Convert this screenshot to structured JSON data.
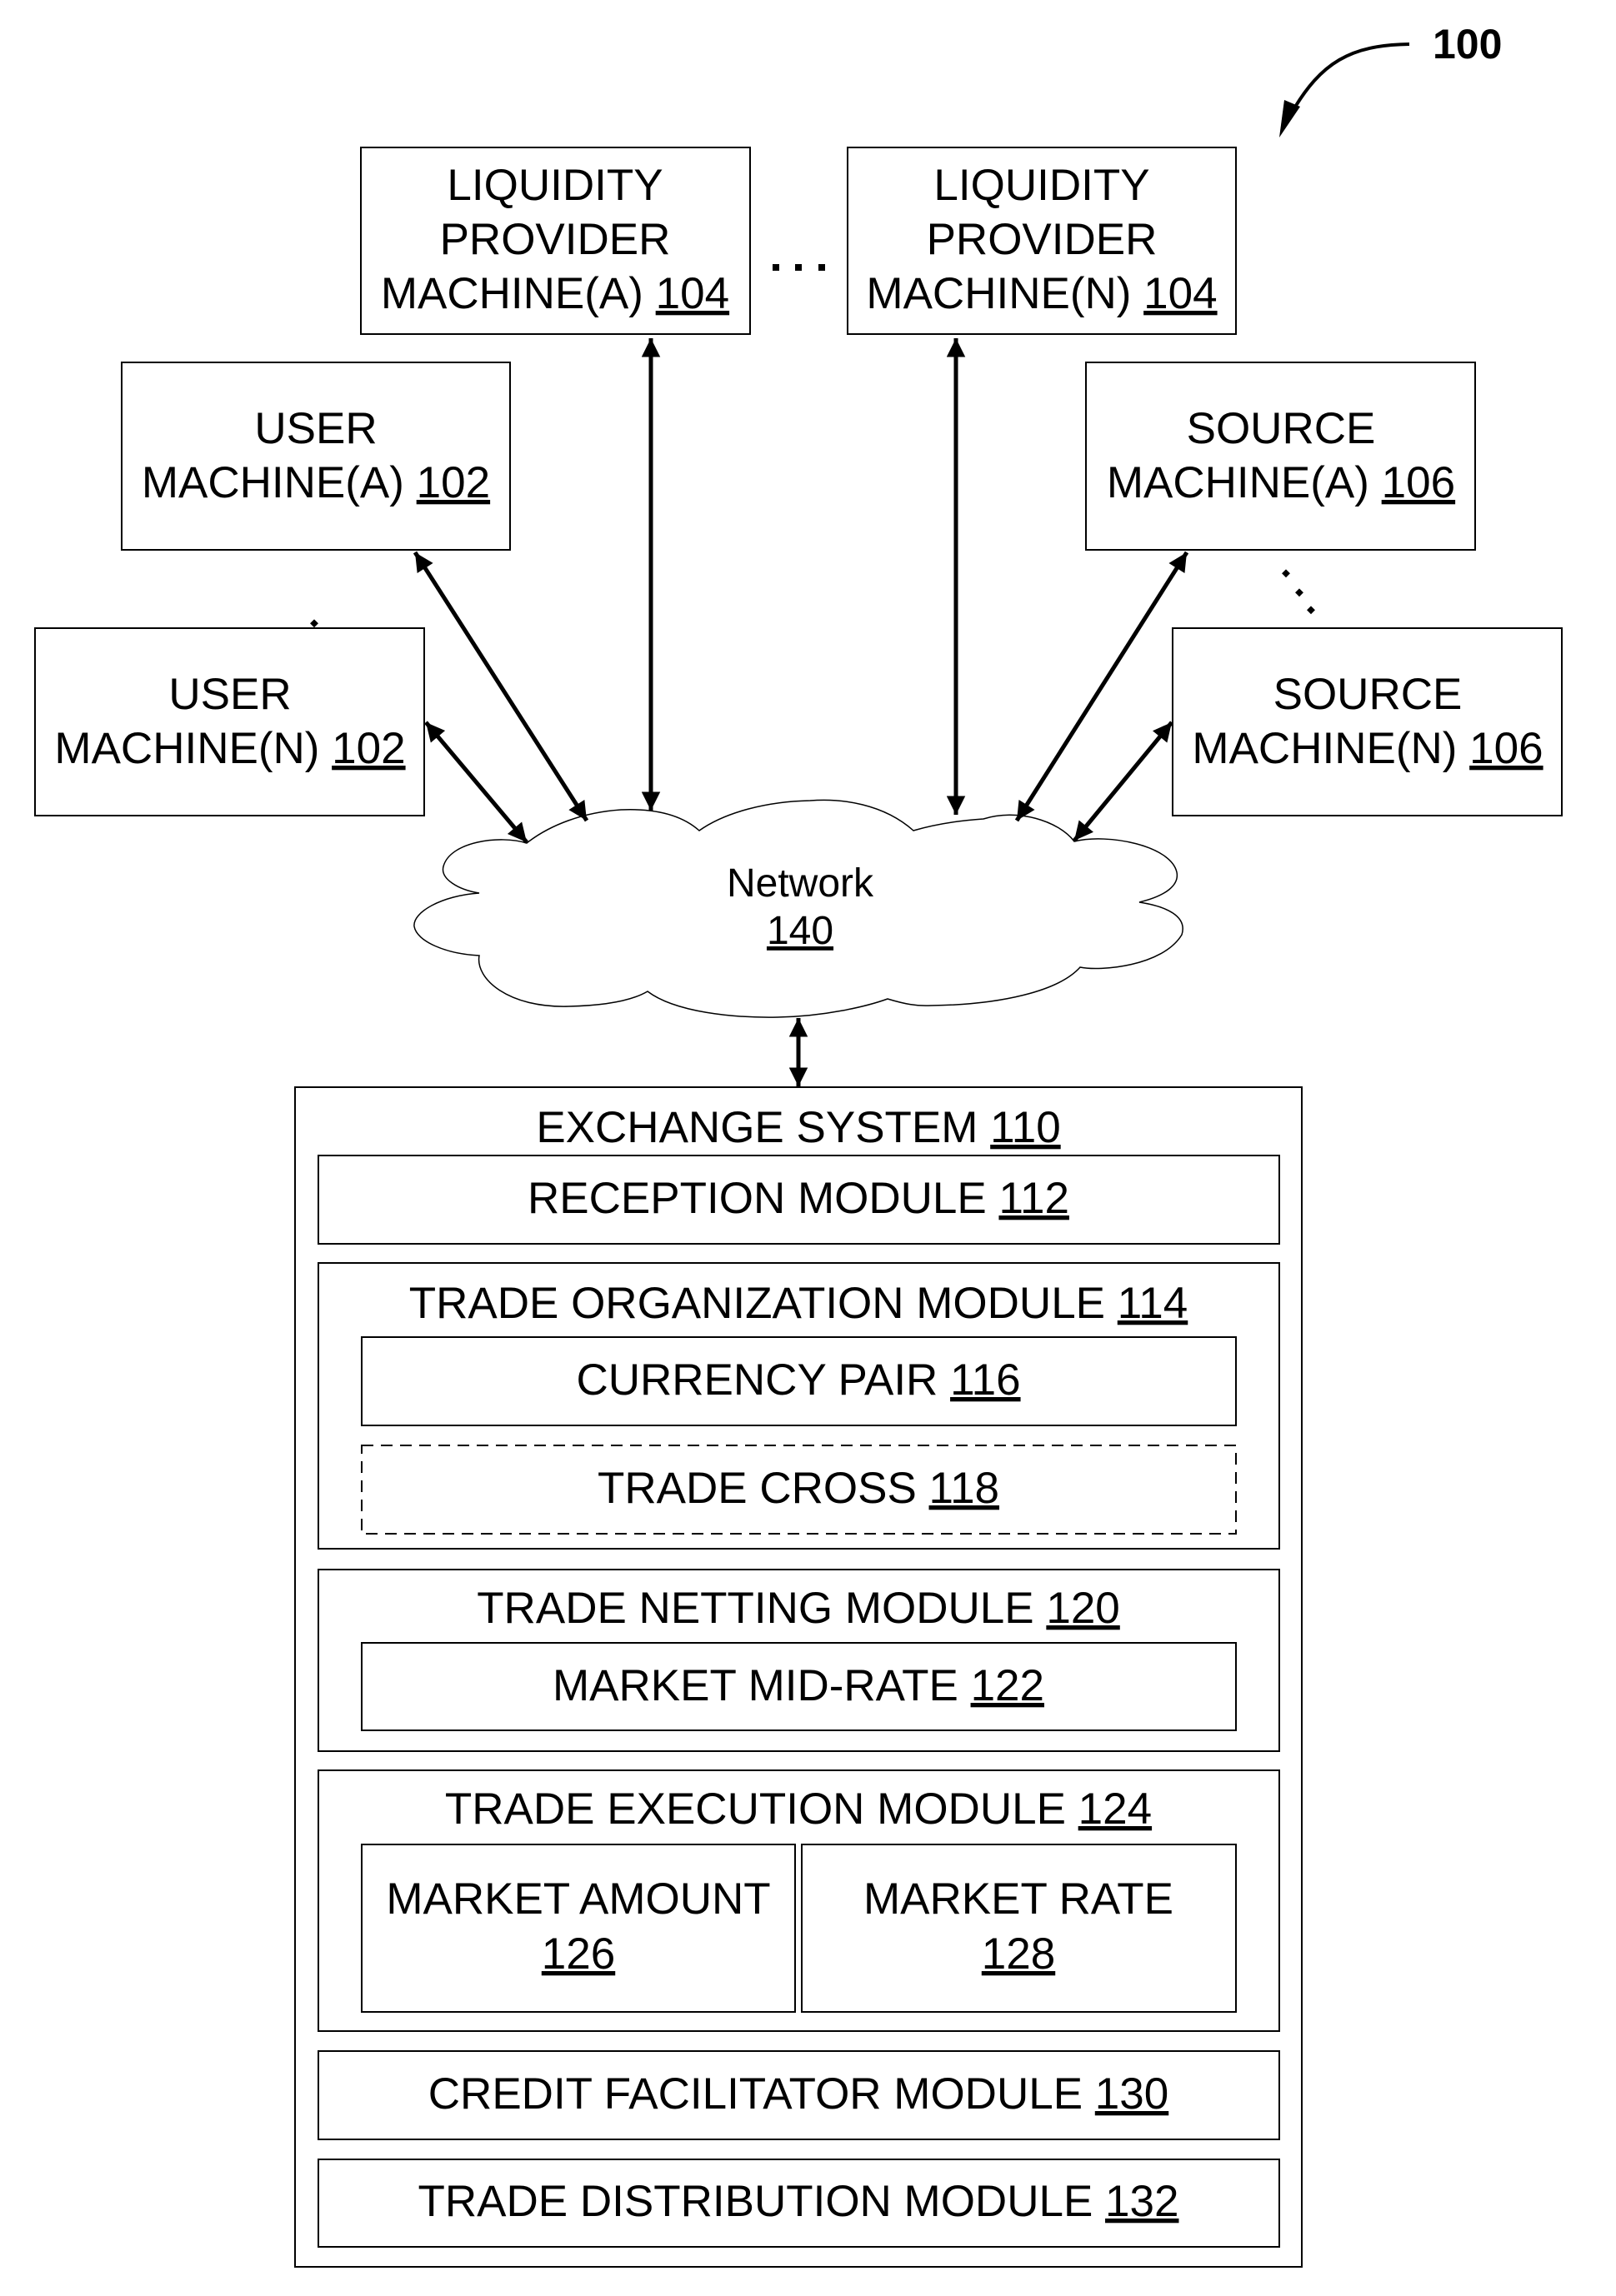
{
  "figure": {
    "reference_label": "100"
  },
  "liquidity_providers": [
    {
      "lines": [
        "LIQUIDITY",
        "PROVIDER",
        "MACHINE(A)"
      ],
      "ref": "104"
    },
    {
      "lines": [
        "LIQUIDITY",
        "PROVIDER",
        "MACHINE(N)"
      ],
      "ref": "104"
    }
  ],
  "user_machines": [
    {
      "lines": [
        "USER",
        "MACHINE(A)"
      ],
      "ref": "102"
    },
    {
      "lines": [
        "USER",
        "MACHINE(N)"
      ],
      "ref": "102"
    }
  ],
  "source_machines": [
    {
      "lines": [
        "SOURCE",
        "MACHINE(A)"
      ],
      "ref": "106"
    },
    {
      "lines": [
        "SOURCE",
        "MACHINE(N)"
      ],
      "ref": "106"
    }
  ],
  "network": {
    "label": "Network",
    "ref": "140"
  },
  "exchange_system": {
    "title": "EXCHANGE SYSTEM",
    "ref": "110",
    "modules": {
      "reception": {
        "label": "RECEPTION MODULE",
        "ref": "112"
      },
      "trade_organization": {
        "label": "TRADE ORGANIZATION MODULE",
        "ref": "114",
        "currency_pair": {
          "label": "CURRENCY PAIR",
          "ref": "116"
        },
        "trade_cross": {
          "label": "TRADE CROSS",
          "ref": "118",
          "style": "dashed"
        }
      },
      "trade_netting": {
        "label": "TRADE NETTING MODULE",
        "ref": "120",
        "market_mid_rate": {
          "label": "MARKET MID-RATE",
          "ref": "122"
        }
      },
      "trade_execution": {
        "label": "TRADE EXECUTION MODULE",
        "ref": "124",
        "market_amount": {
          "label": "MARKET AMOUNT",
          "ref": "126"
        },
        "market_rate": {
          "label": "MARKET RATE",
          "ref": "128"
        }
      },
      "credit_facilitator": {
        "label": "CREDIT FACILITATOR MODULE",
        "ref": "130"
      },
      "trade_distribution": {
        "label": "TRADE DISTRIBUTION MODULE",
        "ref": "132"
      }
    }
  },
  "ellipsis": "..."
}
